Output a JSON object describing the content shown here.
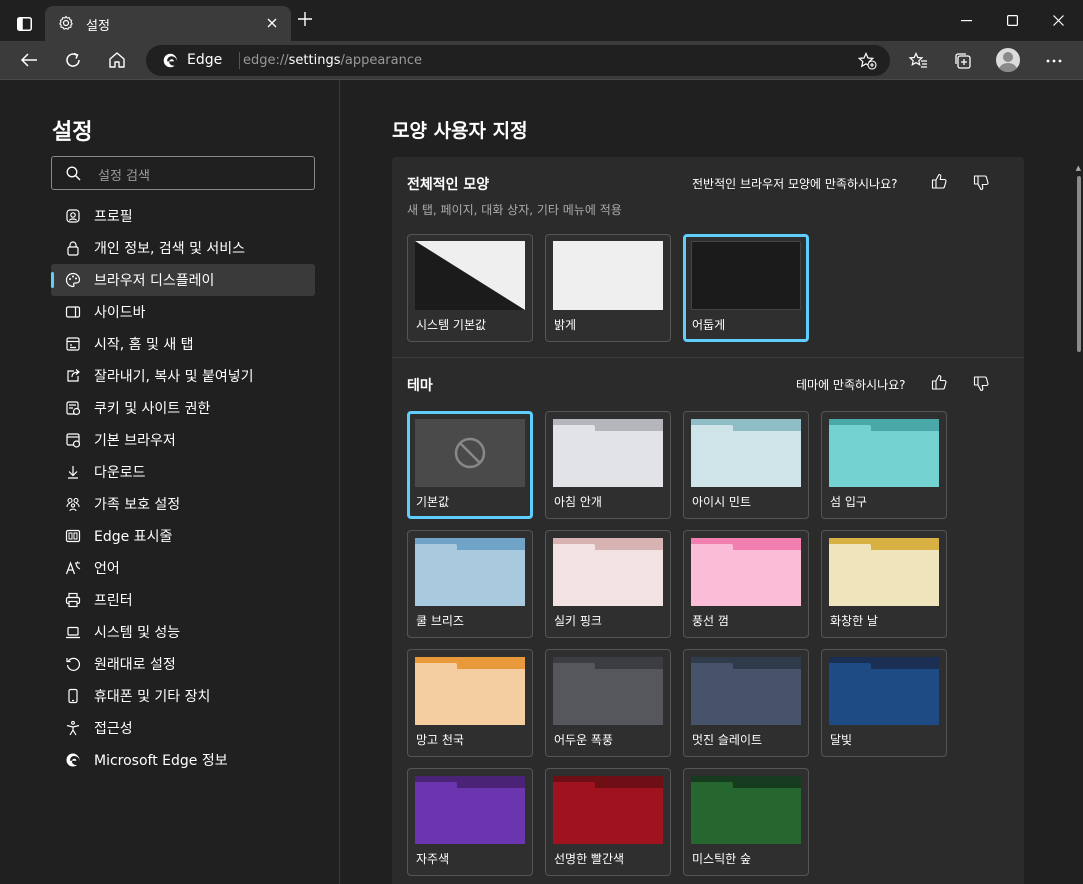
{
  "browser": {
    "tab_title": "설정",
    "brand": "Edge",
    "url_prefix": "edge://",
    "url_bold": "settings",
    "url_suffix": "/appearance"
  },
  "sidebar": {
    "title": "설정",
    "search_placeholder": "설정 검색",
    "items": [
      {
        "label": "프로필",
        "icon": "profile-icon"
      },
      {
        "label": "개인 정보, 검색 및 서비스",
        "icon": "lock-icon"
      },
      {
        "label": "브라우저 디스플레이",
        "icon": "palette-icon",
        "active": true
      },
      {
        "label": "사이드바",
        "icon": "sidebar-icon"
      },
      {
        "label": "시작, 홈 및 새 탭",
        "icon": "newtab-icon"
      },
      {
        "label": "잘라내기, 복사 및 붙여넣기",
        "icon": "share-icon"
      },
      {
        "label": "쿠키 및 사이트 권한",
        "icon": "cookie-icon"
      },
      {
        "label": "기본 브라우저",
        "icon": "browser-icon"
      },
      {
        "label": "다운로드",
        "icon": "download-icon"
      },
      {
        "label": "가족 보호 설정",
        "icon": "family-icon"
      },
      {
        "label": "Edge 표시줄",
        "icon": "edgebar-icon"
      },
      {
        "label": "언어",
        "icon": "language-icon"
      },
      {
        "label": "프린터",
        "icon": "printer-icon"
      },
      {
        "label": "시스템 및 성능",
        "icon": "laptop-icon"
      },
      {
        "label": "원래대로 설정",
        "icon": "reset-icon"
      },
      {
        "label": "휴대폰 및 기타 장치",
        "icon": "phone-icon"
      },
      {
        "label": "접근성",
        "icon": "accessibility-icon"
      },
      {
        "label": "Microsoft Edge 정보",
        "icon": "edge-logo-icon"
      }
    ]
  },
  "main": {
    "page_title": "모양 사용자 지정",
    "overall": {
      "title": "전체적인 모양",
      "subtitle": "새 탭, 페이지, 대화 상자, 기타 메뉴에 적용",
      "feedback": "전반적인 브라우저 모양에 만족하시나요?",
      "options": [
        {
          "label": "시스템 기본값",
          "selected": false
        },
        {
          "label": "밝게",
          "selected": false
        },
        {
          "label": "어둡게",
          "selected": true
        }
      ]
    },
    "theme": {
      "title": "테마",
      "feedback": "테마에 만족하시나요?",
      "items": [
        {
          "label": "기본값",
          "top": "#3d3d3d",
          "body": "#4a4a4a",
          "selected": true,
          "default": true
        },
        {
          "label": "아침 안개",
          "top": "#b4b6bb",
          "body": "#e2e3e7"
        },
        {
          "label": "아이시 민트",
          "top": "#8ebdc6",
          "body": "#cfe4e8"
        },
        {
          "label": "섬 입구",
          "top": "#4aa8a8",
          "body": "#74d3d1"
        },
        {
          "label": "쿨 브리즈",
          "top": "#6fa3c7",
          "body": "#a9c9df"
        },
        {
          "label": "실키 핑크",
          "top": "#d8b3b3",
          "body": "#f2e2e2"
        },
        {
          "label": "풍선 껌",
          "top": "#f27fb0",
          "body": "#fbbcd7"
        },
        {
          "label": "화창한 날",
          "top": "#d9b043",
          "body": "#f0e4bd"
        },
        {
          "label": "망고 천국",
          "top": "#e89a3a",
          "body": "#f4cda1"
        },
        {
          "label": "어두운 폭풍",
          "top": "#3c3d42",
          "body": "#55575d"
        },
        {
          "label": "멋진 슬레이트",
          "top": "#2f3a4b",
          "body": "#46536a"
        },
        {
          "label": "달빛",
          "top": "#1b2f55",
          "body": "#1f4b85"
        },
        {
          "label": "자주색",
          "top": "#4a2377",
          "body": "#6b35b0"
        },
        {
          "label": "선명한 빨간색",
          "top": "#6e0f16",
          "body": "#a0131e"
        },
        {
          "label": "미스틱한 숲",
          "top": "#173b1e",
          "body": "#25672f"
        }
      ]
    }
  }
}
